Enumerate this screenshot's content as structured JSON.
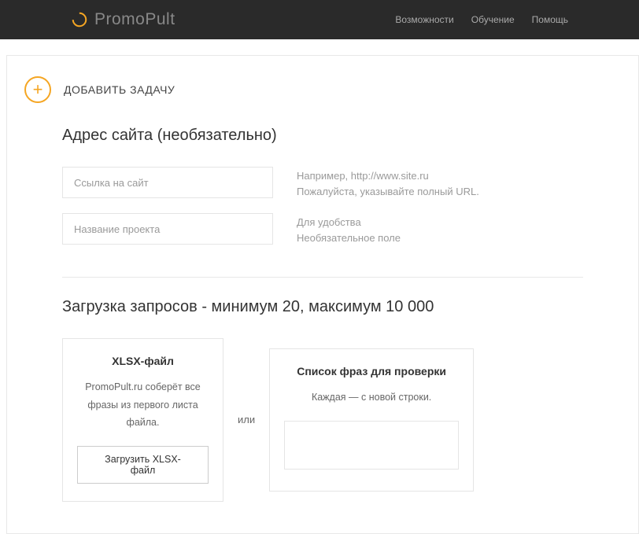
{
  "header": {
    "logo_text": "PromoPult",
    "nav": [
      "Возможности",
      "Обучение",
      "Помощь"
    ]
  },
  "add_task": {
    "label": "ДОБАВИТЬ ЗАДАЧУ"
  },
  "site_section": {
    "title": "Адрес сайта (необязательно)",
    "url_placeholder": "Ссылка на сайт",
    "url_hint_1": "Например, http://www.site.ru",
    "url_hint_2": "Пожалуйста, указывайте полный URL.",
    "name_placeholder": "Название проекта",
    "name_hint_1": "Для удобства",
    "name_hint_2": "Необязательное поле"
  },
  "upload_section": {
    "title": "Загрузка запросов - минимум 20, максимум 10 000",
    "card_left": {
      "title": "XLSX-файл",
      "desc": "PromoPult.ru соберёт все фразы из первого листа файла.",
      "button": "Загрузить XLSX-файл"
    },
    "or": "или",
    "card_right": {
      "title": "Список фраз для проверки",
      "desc": "Каждая — с новой строки."
    }
  }
}
